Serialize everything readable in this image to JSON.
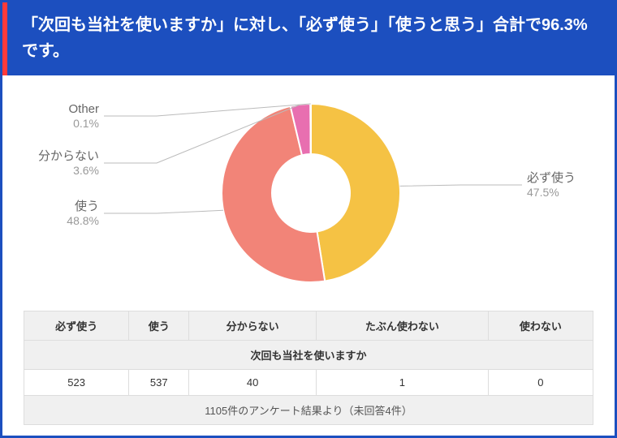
{
  "header": "「次回も当社を使いますか」に対し、「必ず使う」「使うと思う」合計で96.3%です。",
  "chart_data": {
    "type": "pie",
    "title": "",
    "series": [
      {
        "name": "必ず使う",
        "value": 47.5,
        "count": 523,
        "color": "#f5c244"
      },
      {
        "name": "使う",
        "value": 48.8,
        "count": 537,
        "color": "#f28478"
      },
      {
        "name": "分からない",
        "value": 3.6,
        "count": 40,
        "color": "#e86fb0"
      },
      {
        "name": "Other",
        "value": 0.1,
        "count": 1,
        "color": "#777777"
      }
    ],
    "label_format": "{name}\n{value}%"
  },
  "table": {
    "caption": "次回も当社を使いますか",
    "columns": [
      "必ず使う",
      "使う",
      "分からない",
      "たぶん使わない",
      "使わない"
    ],
    "row": [
      523,
      537,
      40,
      1,
      0
    ],
    "footer": "1105件のアンケート結果より（未回答4件）"
  }
}
